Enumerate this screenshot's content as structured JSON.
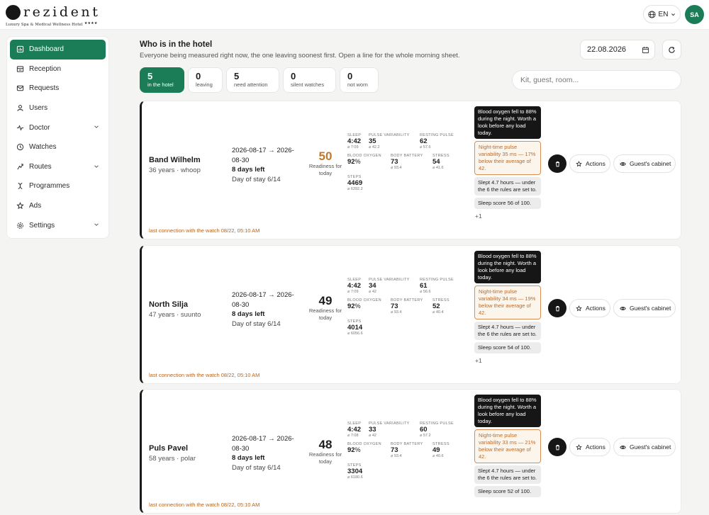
{
  "brand": {
    "name": "rezident",
    "tagline": "Luxury Spa & Medical Wellness Hotel",
    "stars": "★★★★"
  },
  "lang": {
    "label": "EN"
  },
  "user": {
    "initials": "SA"
  },
  "sidebar": {
    "items": [
      {
        "label": "Dashboard",
        "icon": "dashboard-icon",
        "active": true
      },
      {
        "label": "Reception",
        "icon": "reception-icon"
      },
      {
        "label": "Requests",
        "icon": "mail-icon"
      },
      {
        "label": "Users",
        "icon": "user-icon"
      },
      {
        "label": "Doctor",
        "icon": "pulse-icon",
        "expandable": true
      },
      {
        "label": "Watches",
        "icon": "clock-icon"
      },
      {
        "label": "Routes",
        "icon": "route-icon",
        "expandable": true
      },
      {
        "label": "Programmes",
        "icon": "dna-icon"
      },
      {
        "label": "Ads",
        "icon": "star-icon"
      },
      {
        "label": "Settings",
        "icon": "gear-icon",
        "expandable": true
      }
    ]
  },
  "header": {
    "title": "Who is in the hotel",
    "subtitle": "Everyone being measured right now, the one leaving soonest first. Open a line for the whole morning sheet.",
    "date": "22.08.2026"
  },
  "tiles": [
    {
      "num": "5",
      "label": "in the hotel",
      "active": true
    },
    {
      "num": "0",
      "label": "leaving"
    },
    {
      "num": "5",
      "label": "need attention"
    },
    {
      "num": "0",
      "label": "silent watches"
    },
    {
      "num": "0",
      "label": "not worn"
    }
  ],
  "search": {
    "placeholder": "Kit, guest, room..."
  },
  "labels": {
    "readiness": "Readiness for today",
    "sleep": "SLEEP",
    "pulse_variability": "PULSE VARIABILITY",
    "resting_pulse": "RESTING PULSE",
    "blood_oxygen": "BLOOD OXYGEN",
    "body_battery": "BODY BATTERY",
    "stress": "STRESS",
    "steps": "STEPS",
    "actions": "Actions",
    "cabinet": "Guest's cabinet"
  },
  "guests": [
    {
      "name": "Band Wilhelm",
      "meta": "36 years · whoop",
      "dates": "2026-08-17 → 2026-08-30",
      "days_left": "8 days left",
      "day_of_stay": "Day of stay 6/14",
      "readiness": "50",
      "readiness_color": "#c0772c",
      "sleep": "4:42",
      "sleep_avg": "⌀ 7:09",
      "pulse_var": "35",
      "pulse_var_avg": "⌀ 42.2",
      "resting": "62",
      "resting_avg": "⌀ 57.6",
      "oxygen": "92",
      "oxygen_unit": "%",
      "battery": "73",
      "battery_avg": "⌀ 93.4",
      "stress": "54",
      "stress_avg": "⌀ 41.6",
      "steps": "4469",
      "steps_avg": "⌀ 6392.2",
      "alert1": "Blood oxygen fell to 88% during the night. Worth a look before any load today.",
      "alert2": "Night-time pulse variability 35 ms — 17% below their average of 42.",
      "alert3": "Slept 4.7 hours — under the 6 the rules are set to.",
      "alert4": "Sleep score 56 of 100.",
      "more": "+1",
      "connection": "last connection with the watch 08/22, 05:10 AM"
    },
    {
      "name": "North Silja",
      "meta": "47 years · suunto",
      "dates": "2026-08-17 → 2026-08-30",
      "days_left": "8 days left",
      "day_of_stay": "Day of stay 6/14",
      "readiness": "49",
      "readiness_color": "#1d1d1d",
      "sleep": "4:42",
      "sleep_avg": "⌀ 7:09",
      "pulse_var": "34",
      "pulse_var_avg": "⌀ 42",
      "resting": "61",
      "resting_avg": "⌀ 56.6",
      "oxygen": "92",
      "oxygen_unit": "%",
      "battery": "73",
      "battery_avg": "⌀ 93.4",
      "stress": "52",
      "stress_avg": "⌀ 40.4",
      "steps": "4014",
      "steps_avg": "⌀ 6056.6",
      "alert1": "Blood oxygen fell to 88% during the night. Worth a look before any load today.",
      "alert2": "Night-time pulse variability 34 ms — 19% below their average of 42.",
      "alert3": "Slept 4.7 hours — under the 6 the rules are set to.",
      "alert4": "Sleep score 54 of 100.",
      "more": "+1",
      "connection": "last connection with the watch 08/22, 05:10 AM"
    },
    {
      "name": "Puls Pavel",
      "meta": "58 years · polar",
      "dates": "2026-08-17 → 2026-08-30",
      "days_left": "8 days left",
      "day_of_stay": "Day of stay 6/14",
      "readiness": "48",
      "readiness_color": "#1d1d1d",
      "sleep": "4:42",
      "sleep_avg": "⌀ 7:08",
      "pulse_var": "33",
      "pulse_var_avg": "⌀ 42",
      "resting": "60",
      "resting_avg": "⌀ 57.2",
      "oxygen": "92",
      "oxygen_unit": "%",
      "battery": "73",
      "battery_avg": "⌀ 93.4",
      "stress": "49",
      "stress_avg": "⌀ 40.6",
      "steps": "3304",
      "steps_avg": "⌀ 6180.6",
      "alert1": "Blood oxygen fell to 88% during the night. Worth a look before any load today.",
      "alert2": "Night-time pulse variability 33 ms — 21% below their average of 42.",
      "alert3": "Slept 4.7 hours — under the 6 the rules are set to.",
      "alert4": "Sleep score 52 of 100.",
      "more": "",
      "connection": "last connection with the watch 08/22, 05:10 AM"
    }
  ]
}
